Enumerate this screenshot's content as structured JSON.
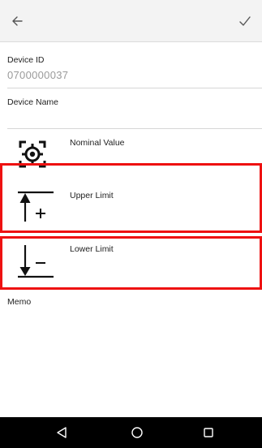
{
  "header": {
    "back_icon": "arrow-left-icon",
    "done_icon": "checkmark-icon"
  },
  "device_id": {
    "label": "Device ID",
    "value": "0700000037"
  },
  "device_name": {
    "label": "Device Name",
    "value": ""
  },
  "nominal": {
    "label": "Nominal Value",
    "icon": "target-crosshair-icon"
  },
  "upper": {
    "label": "Upper Limit",
    "icon": "upper-limit-icon"
  },
  "lower": {
    "label": "Lower Limit",
    "icon": "lower-limit-icon"
  },
  "memo": {
    "label": "Memo"
  },
  "highlight_color": "#ee1111",
  "nav": {
    "back_icon": "triangle-back-icon",
    "home_icon": "circle-home-icon",
    "recents_icon": "square-recents-icon"
  }
}
